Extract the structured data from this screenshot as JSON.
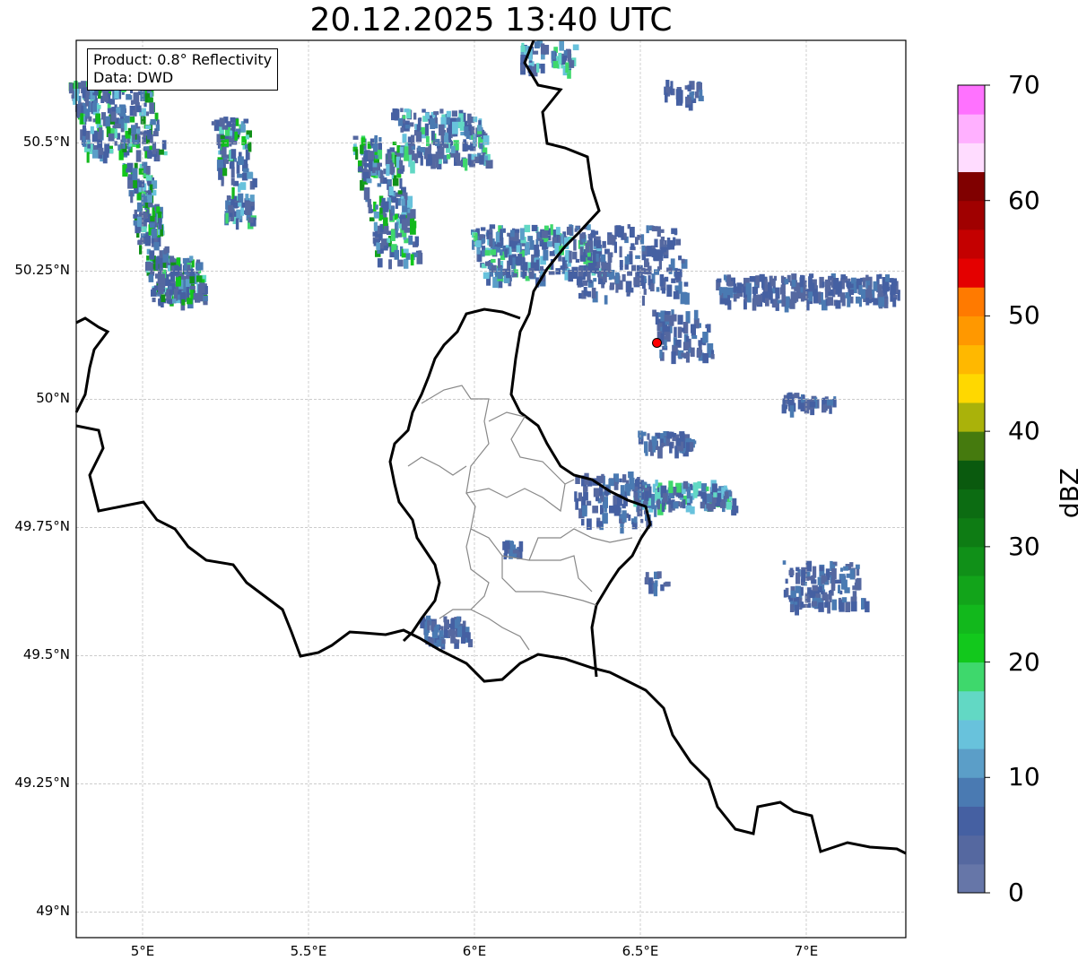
{
  "title": "20.12.2025 13:40 UTC",
  "info_box": {
    "product": "Product: 0.8° Reflectivity",
    "data_source": "Data: DWD"
  },
  "map": {
    "lon_ticks": [
      "5°E",
      "5.5°E",
      "6°E",
      "6.5°E",
      "7°E"
    ],
    "lat_ticks": [
      "50.5°N",
      "50.25°N",
      "50°N",
      "49.75°N",
      "49.5°N",
      "49.25°N",
      "49°N"
    ],
    "extent": {
      "lon_min": 4.8,
      "lon_max": 7.3,
      "lat_min": 48.95,
      "lat_max": 50.7
    },
    "marker": {
      "lon": 6.55,
      "lat": 50.11,
      "color": "#ff0000"
    },
    "gridlines": true
  },
  "colorbar": {
    "label": "dBZ",
    "tick_labels": [
      "0",
      "10",
      "20",
      "30",
      "40",
      "50",
      "60",
      "70"
    ],
    "range": [
      0,
      70
    ],
    "bin_size": 2.5,
    "colors": [
      "#6676a8",
      "#5568a0",
      "#4560a2",
      "#4a7ab2",
      "#5b9ec8",
      "#68c2dc",
      "#62d8c4",
      "#3ed86c",
      "#12c81c",
      "#12b81c",
      "#12a41a",
      "#109018",
      "#0e7c14",
      "#0c6c12",
      "#0a5a0e",
      "#457a0e",
      "#aab20a",
      "#ffd800",
      "#ffb800",
      "#ff9800",
      "#ff7a00",
      "#e40000",
      "#c40000",
      "#a00000",
      "#800000",
      "#ffdcff",
      "#ffb0ff",
      "#ff72ff",
      "#ec3cf0"
    ]
  }
}
